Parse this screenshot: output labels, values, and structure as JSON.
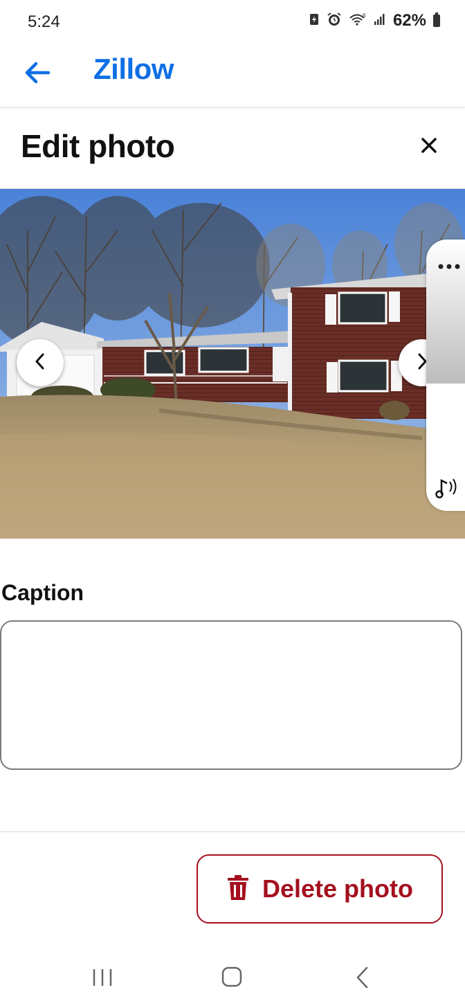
{
  "status_bar": {
    "time": "5:24",
    "battery_percent": "62%",
    "icons": [
      "battery-saver-icon",
      "alarm-icon",
      "wifi-icon",
      "signal-icon",
      "battery-icon"
    ]
  },
  "app_bar": {
    "title": "Zillow",
    "back_icon": "arrow-left-icon",
    "accent_color": "#0f6fe4"
  },
  "edit_photo": {
    "title": "Edit photo",
    "close_icon": "close-icon"
  },
  "photo": {
    "prev_icon": "chevron-left-icon",
    "next_icon": "chevron-right-icon",
    "side_panel": {
      "more_icon": "more-horizontal-icon",
      "sound_icon": "music-note-icon"
    }
  },
  "caption": {
    "label": "Caption",
    "value": ""
  },
  "delete": {
    "label": "Delete photo",
    "icon": "trash-icon",
    "color": "#a4101e"
  },
  "system_nav": {
    "recents_icon": "recents-icon",
    "home_icon": "home-icon",
    "back_icon": "back-icon"
  }
}
